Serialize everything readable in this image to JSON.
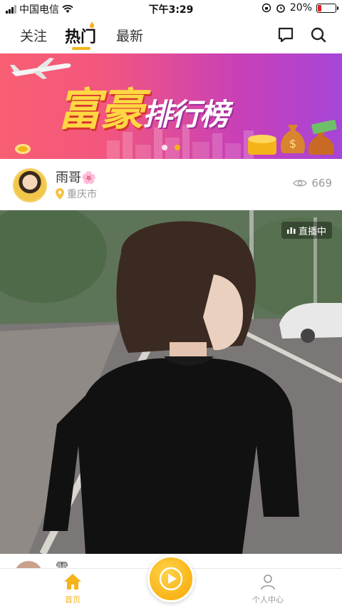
{
  "status_bar": {
    "carrier": "中国电信",
    "time": "下午3:29",
    "battery": "20%",
    "battery_level": 0.2,
    "icons": [
      "signal-icon",
      "wifi-icon",
      "orientation-lock-icon",
      "alarm-icon",
      "battery-icon"
    ]
  },
  "top_nav": {
    "tabs": [
      {
        "label": "关注"
      },
      {
        "label": "热门"
      },
      {
        "label": "最新"
      }
    ],
    "active_tab": "热门",
    "icons": [
      "message-icon",
      "search-icon"
    ],
    "accent_color": "#f5b31a"
  },
  "banner": {
    "title_main": "富豪",
    "title_sub": "排行榜",
    "dots": 2,
    "active_dot": 1
  },
  "post": {
    "username": "雨哥",
    "username_emoji": "🌸",
    "location": "重庆市",
    "views": "669",
    "live_badge": "直播中"
  },
  "next_post": {
    "username_text": "雷"
  },
  "bottom_bar": {
    "home_label": "首页",
    "profile_label": "个人中心",
    "home_color": "#f5b31a",
    "icons": [
      "home-icon",
      "play-icon",
      "user-icon"
    ]
  }
}
